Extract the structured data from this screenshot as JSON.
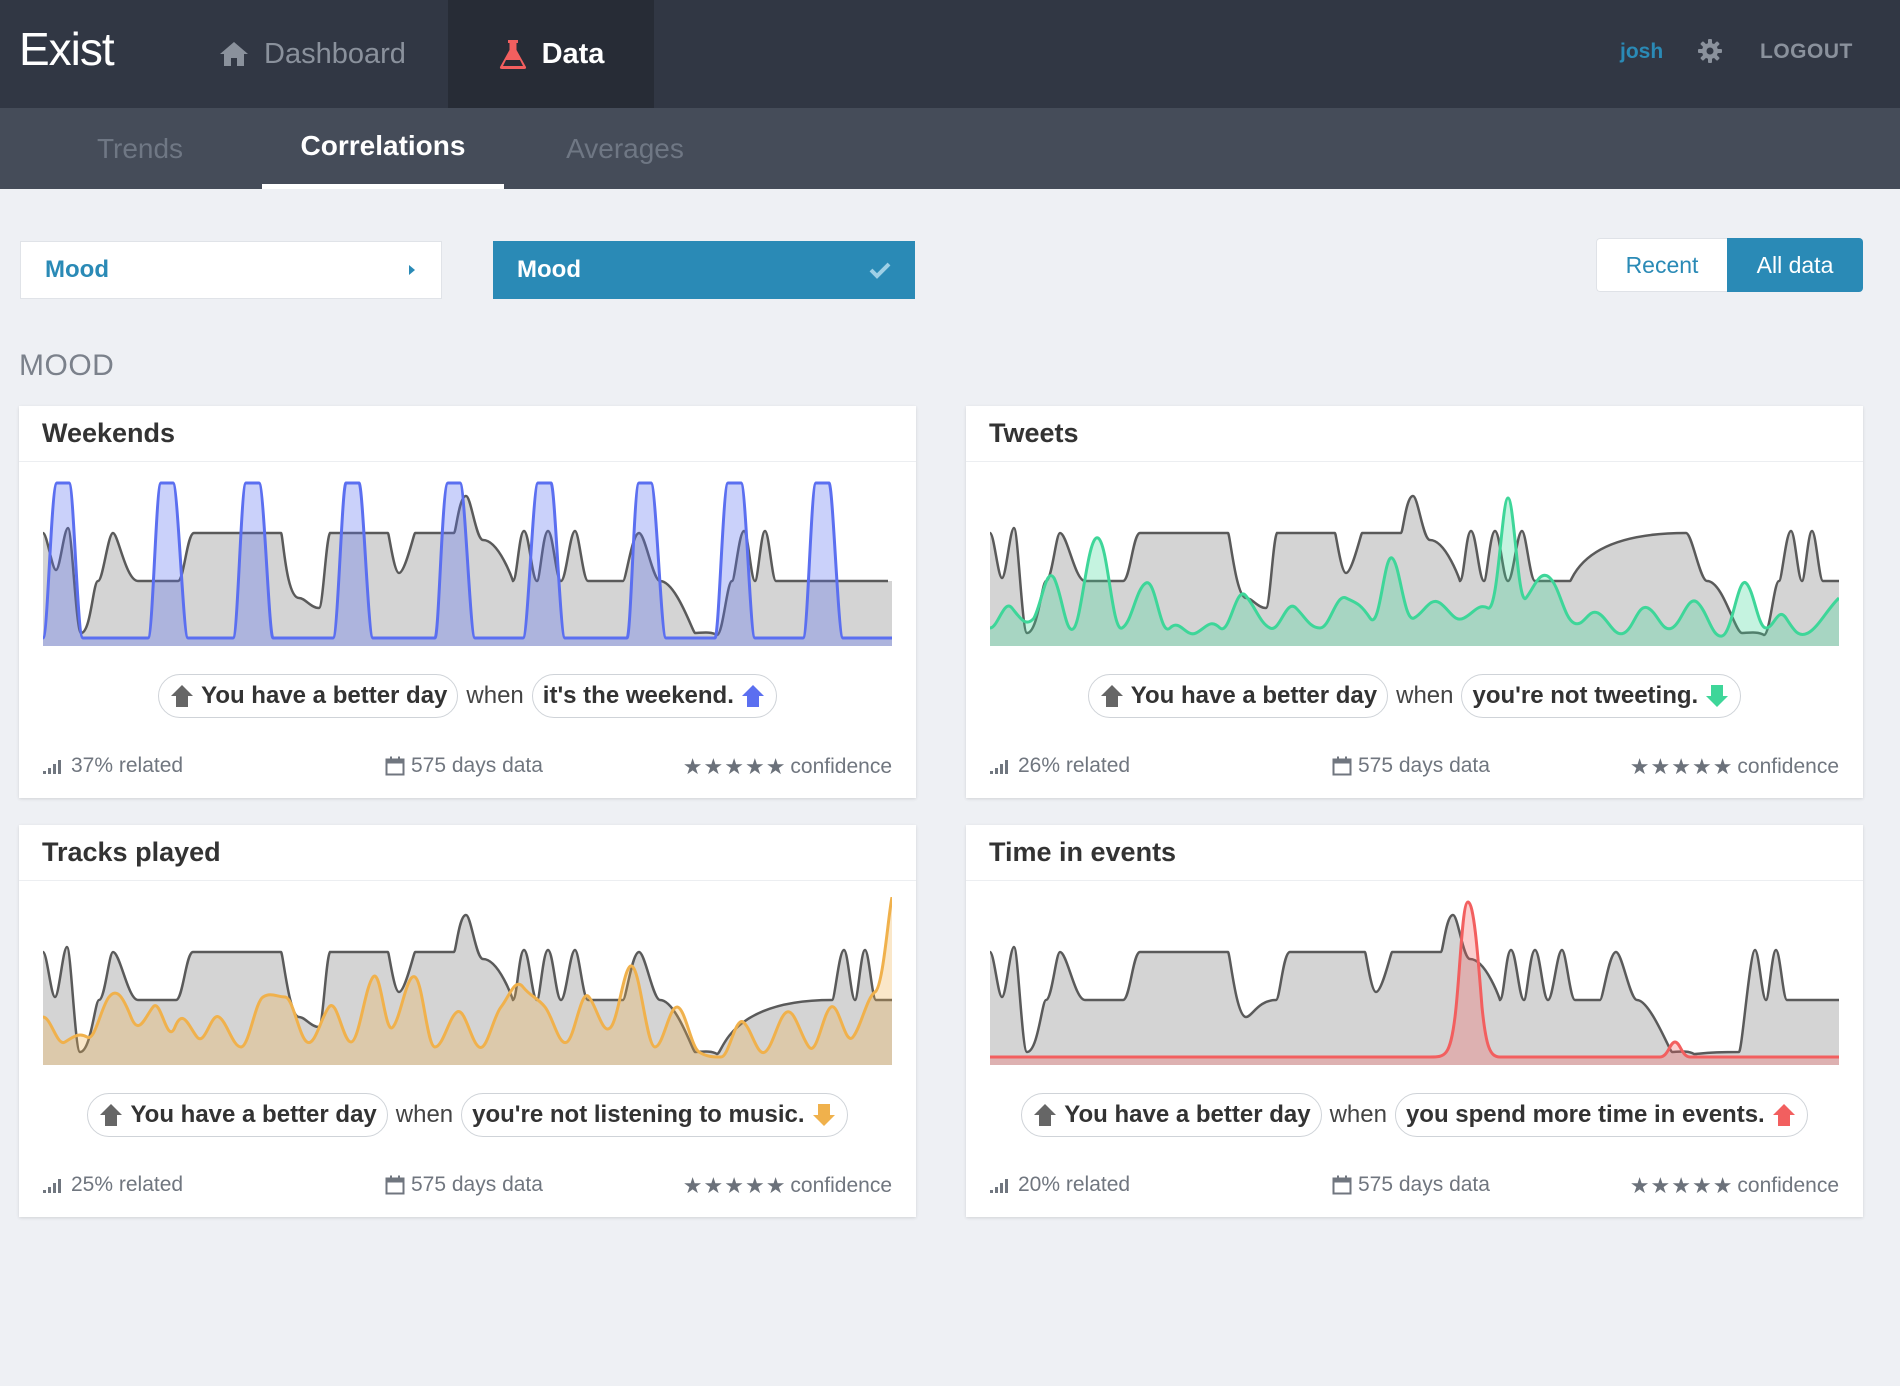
{
  "app": {
    "brand": "Exist"
  },
  "nav": {
    "dashboard_label": "Dashboard",
    "data_label": "Data",
    "user": "josh",
    "logout_label": "LOGOUT"
  },
  "subnav": {
    "trends": "Trends",
    "correlations": "Correlations",
    "averages": "Averages"
  },
  "selectors": {
    "left": "Mood",
    "right": "Mood"
  },
  "toggle": {
    "recent": "Recent",
    "all": "All data"
  },
  "section_title": "MOOD",
  "sentence_prefix": "You have a better day",
  "when": "when",
  "colors": {
    "blue": "#5b6ff0",
    "green": "#3ed699",
    "orange": "#f0b14c",
    "red": "#f25f5f",
    "accent": "#2a8ab6",
    "mood_line": "#5a5a5a",
    "mood_fill": "#d4d4d4"
  },
  "cards": [
    {
      "title": "Weekends",
      "condition": "it's the weekend.",
      "direction": "up",
      "color": "#5b6ff0",
      "related": "37% related",
      "days": "575 days data",
      "confidence": "confidence",
      "stars": "★★★★★"
    },
    {
      "title": "Tweets",
      "condition": "you're not tweeting.",
      "direction": "down",
      "color": "#3ed699",
      "related": "26% related",
      "days": "575 days data",
      "confidence": "confidence",
      "stars": "★★★★★"
    },
    {
      "title": "Tracks played",
      "condition": "you're not listening to music.",
      "direction": "down",
      "color": "#f0b14c",
      "related": "25% related",
      "days": "575 days data",
      "confidence": "confidence",
      "stars": "★★★★★"
    },
    {
      "title": "Time in events",
      "condition": "you spend more time in events.",
      "direction": "up",
      "color": "#f25f5f",
      "related": "20% related",
      "days": "575 days data",
      "confidence": "confidence",
      "stars": "★★★★★"
    }
  ]
}
